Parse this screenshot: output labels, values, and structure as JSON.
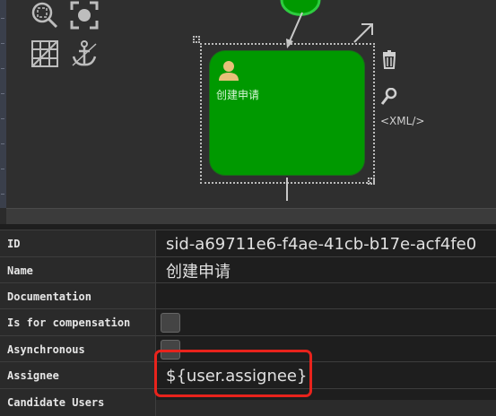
{
  "canvas": {
    "task_label": "创建申请",
    "xml_label": "<XML/>"
  },
  "properties": {
    "rows": [
      {
        "label": "ID",
        "value": "sid-a69711e6-f4ae-41cb-b17e-acf4fe0"
      },
      {
        "label": "Name",
        "value": "创建申请"
      },
      {
        "label": "Documentation",
        "value": ""
      },
      {
        "label": "Is for compensation",
        "value": ""
      },
      {
        "label": "Asynchronous",
        "value": ""
      },
      {
        "label": "Assignee",
        "value": "${user.assignee}"
      },
      {
        "label": "Candidate Users",
        "value": ""
      }
    ]
  },
  "colors": {
    "task_fill": "#009900",
    "highlight": "#e8231c",
    "start_event": "#2ecc40"
  },
  "icons": [
    "zoom-in-icon",
    "zoom-fit-icon",
    "grid-icon",
    "anchor-icon",
    "trash-icon",
    "wrench-icon",
    "user-icon",
    "resize-arrow-icon"
  ]
}
